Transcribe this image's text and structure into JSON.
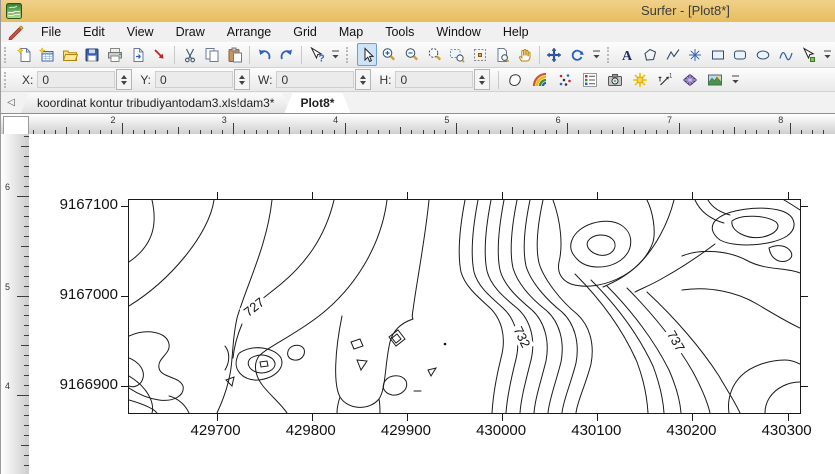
{
  "window": {
    "title": "Surfer - [Plot8*]"
  },
  "menu": {
    "items": [
      "File",
      "Edit",
      "View",
      "Draw",
      "Arrange",
      "Grid",
      "Map",
      "Tools",
      "Window",
      "Help"
    ]
  },
  "toolbars": {
    "standard": [
      "new-document",
      "new-worksheet",
      "open",
      "save",
      "print",
      "export",
      "import",
      "sep",
      "cut",
      "copy",
      "paste",
      "sep",
      "undo",
      "redo",
      "sep",
      "help-pointer",
      "more"
    ],
    "view": [
      "select",
      "zoom-in",
      "zoom-out",
      "zoom-selected",
      "zoom-window",
      "zoom-realtime",
      "print-preview",
      "pan",
      "sep",
      "move",
      "rotate",
      "more"
    ],
    "draw": [
      "text",
      "polygon",
      "polyline",
      "symbol",
      "rectangle",
      "rounded-rectangle",
      "ellipse",
      "spline",
      "reshape",
      "more"
    ],
    "map": [
      "base-map",
      "contour-map",
      "post-map",
      "classed-post-map",
      "image-map",
      "shaded-relief-map",
      "vector-map",
      "wireframe-map",
      "surface-map",
      "more"
    ],
    "active_tool": "select"
  },
  "position_bar": {
    "fields": [
      {
        "label": "X:",
        "value": "0"
      },
      {
        "label": "Y:",
        "value": "0"
      },
      {
        "label": "W:",
        "value": "0"
      },
      {
        "label": "H:",
        "value": "0"
      }
    ]
  },
  "tab_bar": {
    "tabs": [
      {
        "label": "koordinat kontur tribudiyantodam3.xls!dam3*",
        "active": false
      },
      {
        "label": "Plot8*",
        "active": true
      }
    ]
  },
  "rulers": {
    "top_numbers": [
      "2",
      "3",
      "4",
      "5",
      "6",
      "7",
      "8"
    ],
    "left_numbers": [
      "6",
      "5",
      "4"
    ]
  },
  "chart_data": {
    "type": "contour",
    "title": "",
    "x_ticks": [
      429700,
      429800,
      429900,
      430000,
      430100,
      430200,
      430300
    ],
    "y_ticks": [
      9167100,
      9167000,
      9166900
    ],
    "x_range": [
      429608,
      430313
    ],
    "y_range": [
      9166870,
      9167107
    ],
    "contour_levels_labeled": [
      727,
      732,
      737
    ],
    "contour_labels": [
      {
        "value": "727",
        "fx": 0.186,
        "fy": 0.502,
        "angle": -38
      },
      {
        "value": "732",
        "fx": 0.585,
        "fy": 0.643,
        "angle": 64
      },
      {
        "value": "737",
        "fx": 0.815,
        "fy": 0.662,
        "angle": 60
      }
    ],
    "grid": false,
    "legend": false
  }
}
